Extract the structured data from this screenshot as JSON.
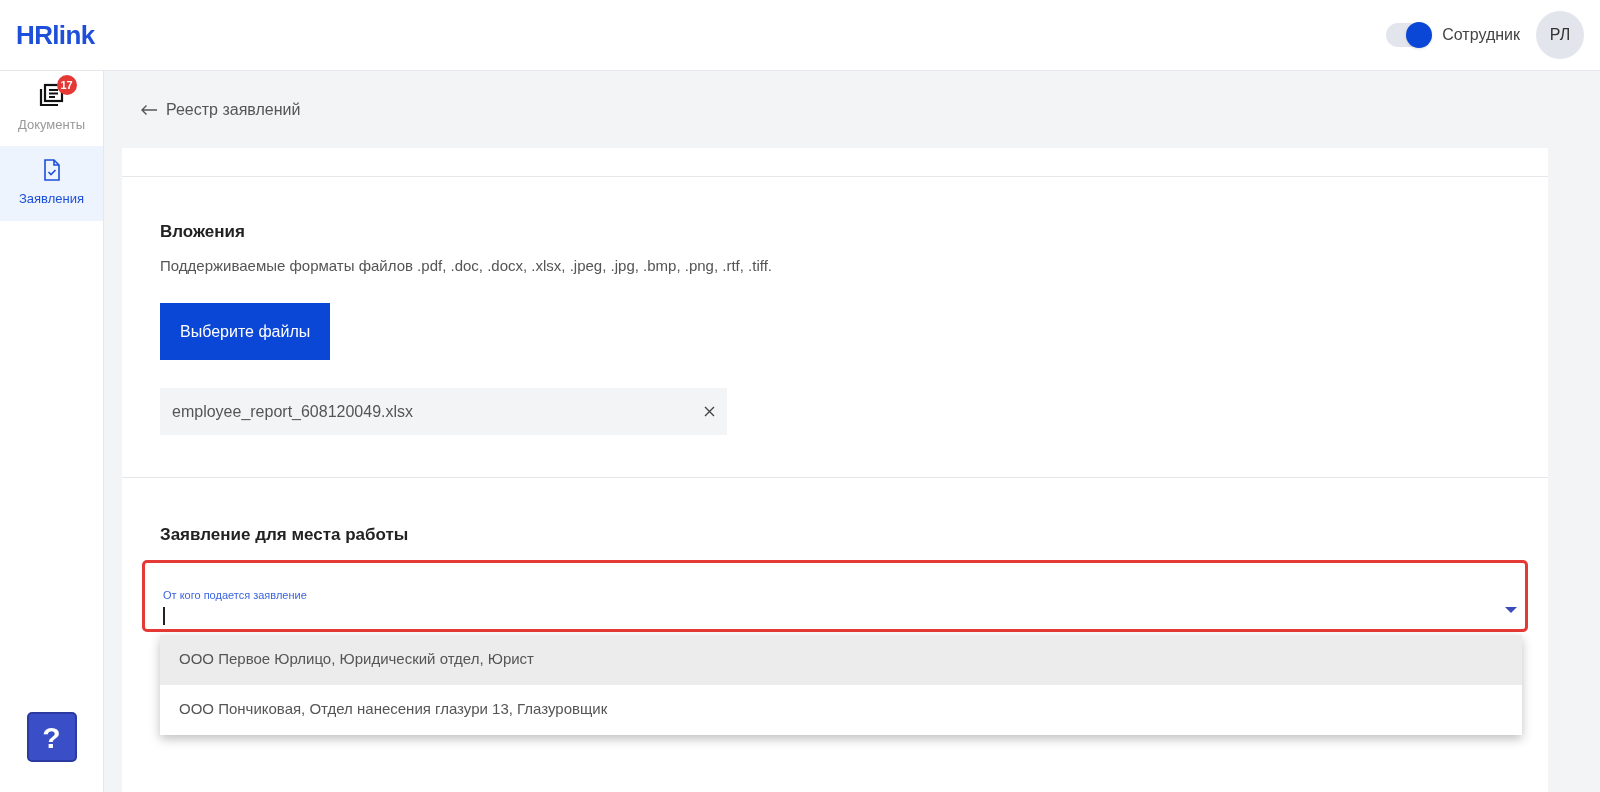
{
  "header": {
    "logo": "HRlink",
    "role_toggle": {
      "on": true,
      "label": "Сотрудник"
    },
    "avatar": "РЛ"
  },
  "sidebar": {
    "items": [
      {
        "label": "Документы",
        "kind": "documents",
        "badge": "17",
        "selected": false
      },
      {
        "label": "Заявления",
        "kind": "application",
        "selected": true
      }
    ],
    "help": "?"
  },
  "back_link": "Реестр заявлений",
  "attachments": {
    "title": "Вложения",
    "hint": "Поддерживаемые форматы файлов .pdf, .doc, .docx, .xlsx, .jpeg, .jpg, .bmp, .png, .rtf, .tiff.",
    "button": "Выберите файлы",
    "files": [
      {
        "name": "employee_report_608120049.xlsx"
      }
    ]
  },
  "workplace": {
    "title": "Заявление для места работы",
    "field": {
      "label": "От кого подается заявление",
      "outlined": true,
      "expanded": true,
      "options": [
        {
          "label": "ООО Первое Юрлицо, Юридический отдел, Юрист",
          "selected": true
        },
        {
          "label": "ООО Пончиковая, Отдел нанесения глазури 13, Глазуровщик",
          "selected": false
        }
      ]
    }
  }
}
